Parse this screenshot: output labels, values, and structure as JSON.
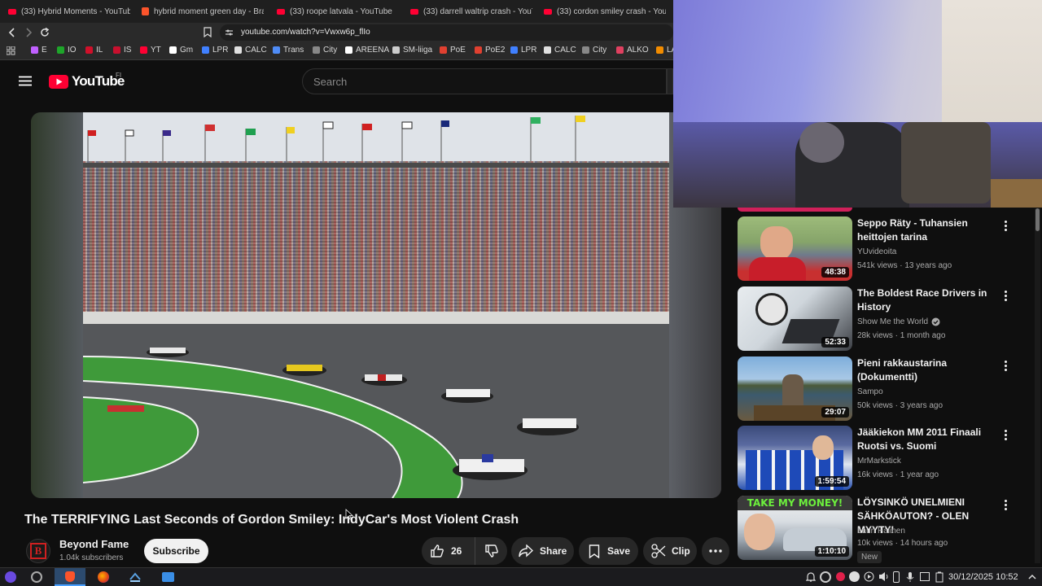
{
  "tabs": [
    {
      "title": "(33) Hybrid Moments - YouTube",
      "icon": "youtube-icon"
    },
    {
      "title": "hybrid moment green day - Bra",
      "icon": "brave-icon"
    },
    {
      "title": "(33) roope latvala - YouTube",
      "icon": "youtube-icon"
    },
    {
      "title": "(33) darrell waltrip crash - YouTu",
      "icon": "youtube-icon"
    },
    {
      "title": "(33) cordon smiley crash - YouTu",
      "icon": "youtube-icon"
    }
  ],
  "address_bar": {
    "url": "youtube.com/watch?v=Vwxw6p_flIo"
  },
  "bookmarks": [
    {
      "label": "E",
      "color": "#c060ff"
    },
    {
      "label": "IO",
      "color": "#1ea52a"
    },
    {
      "label": "IL",
      "color": "#d0102a"
    },
    {
      "label": "IS",
      "color": "#c8102e"
    },
    {
      "label": "YT",
      "color": "#ff0033"
    },
    {
      "label": "Gm",
      "color": "#ffffff"
    },
    {
      "label": "LPR",
      "color": "#4080ff"
    },
    {
      "label": "CALC",
      "color": "#e0e0e0"
    },
    {
      "label": "Trans",
      "color": "#4f8cf6"
    },
    {
      "label": "City",
      "color": "#888888"
    },
    {
      "label": "AREENA",
      "color": "#ffffff"
    },
    {
      "label": "SM-liiga",
      "color": "#cccccc"
    },
    {
      "label": "PoE",
      "color": "#e04030"
    },
    {
      "label": "PoE2",
      "color": "#e04030"
    },
    {
      "label": "LPR",
      "color": "#4080ff"
    },
    {
      "label": "CALC",
      "color": "#e0e0e0"
    },
    {
      "label": "City",
      "color": "#888888"
    },
    {
      "label": "ALKO",
      "color": "#e04060"
    },
    {
      "label": "LA",
      "color": "#f28c00"
    }
  ],
  "youtube": {
    "logo_text": "YouTube",
    "region": "FI",
    "search_placeholder": "Search"
  },
  "video": {
    "title": "The TERRIFYING Last Seconds of Gordon Smiley: IndyCar's Most Violent Crash",
    "channel": "Beyond Fame",
    "subscribers": "1.04k subscribers",
    "subscribe_label": "Subscribe",
    "likes": "26",
    "share_label": "Share",
    "save_label": "Save",
    "clip_label": "Clip"
  },
  "recommendations": [
    {
      "title": "Seppo Räty - Tuhansien heittojen tarina",
      "channel": "YUvideoita",
      "verified": false,
      "meta": "541k views · 13 years ago",
      "duration": "48:38",
      "badge": ""
    },
    {
      "title": "The Boldest Race Drivers in History",
      "channel": "Show Me the World",
      "verified": true,
      "meta": "28k views · 1 month ago",
      "duration": "52:33",
      "badge": ""
    },
    {
      "title": "Pieni rakkaustarina (Dokumentti)",
      "channel": "Sampo",
      "verified": false,
      "meta": "50k views · 3 years ago",
      "duration": "29:07",
      "badge": ""
    },
    {
      "title": "Jääkiekon MM 2011 Finaali Ruotsi vs. Suomi",
      "channel": "MrMarkstick",
      "verified": false,
      "meta": "16k views · 1 year ago",
      "duration": "1:59:54",
      "badge": ""
    },
    {
      "title": "LÖYSINKÖ UNELMIENI SÄHKÖAUTON? - OLEN MYYTY!",
      "channel": "Lauri Halinen",
      "verified": false,
      "meta": "10k views · 14 hours ago",
      "duration": "1:10:10",
      "badge": "New"
    }
  ],
  "thumb_text": {
    "take_my_money": "TAKE MY MONEY!"
  },
  "taskbar": {
    "datetime": "30/12/2025 10:52"
  }
}
